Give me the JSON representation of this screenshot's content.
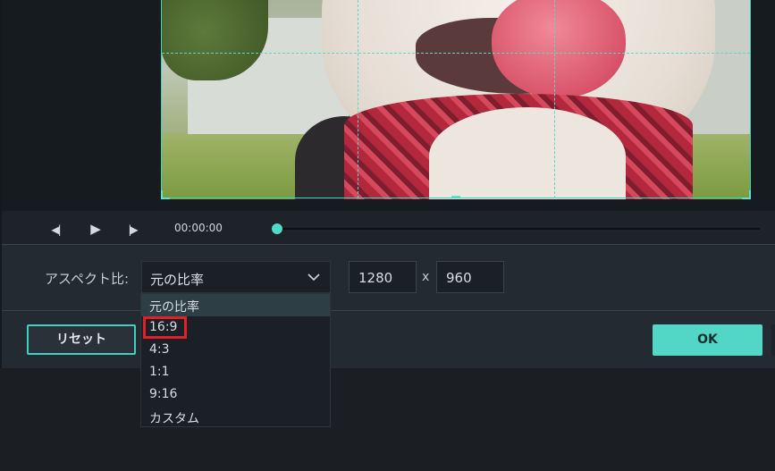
{
  "transport": {
    "timecode": "00:00:00",
    "prev_frame_icon": "◀|",
    "play_icon": "▶",
    "next_frame_icon": "|▶"
  },
  "aspect": {
    "label": "アスペクト比:",
    "selected": "元の比率",
    "width": "1280",
    "times": "x",
    "height": "960",
    "options": [
      "元の比率",
      "16:9",
      "4:3",
      "1:1",
      "9:16",
      "カスタム"
    ],
    "highlighted_option": "16:9"
  },
  "buttons": {
    "reset": "リセット",
    "ok": "OK"
  },
  "colors": {
    "accent": "#52d6c6",
    "highlight": "#e3202a",
    "background": "#232a31"
  }
}
